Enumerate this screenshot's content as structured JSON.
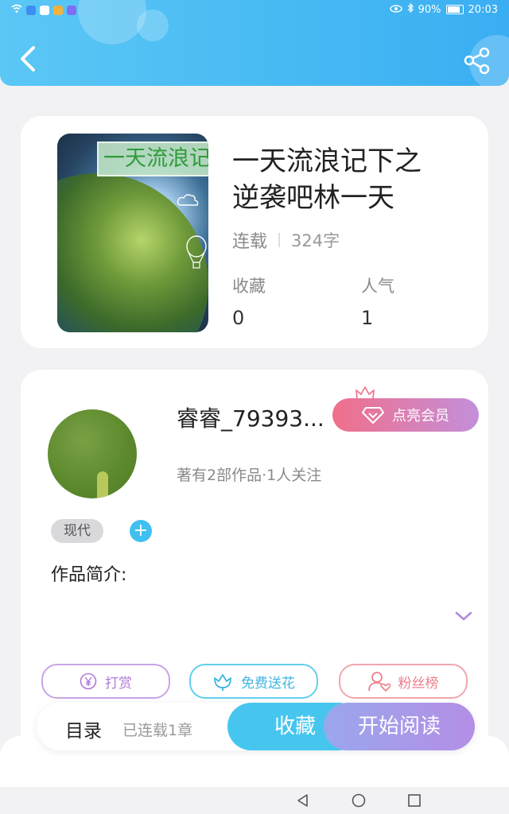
{
  "status": {
    "battery": "90%",
    "time": "20:03"
  },
  "book": {
    "cover_banner": "一天流浪记",
    "title_line1": "一天流浪记下之",
    "title_line2": "逆袭吧林一天",
    "status": "连载",
    "word_count": "324字",
    "favorites_label": "收藏",
    "favorites_value": "0",
    "popularity_label": "人气",
    "popularity_value": "1"
  },
  "author": {
    "name": "睿睿_79393...",
    "vip_label": "点亮会员",
    "info": "著有2部作品·1人关注",
    "genre_tag": "现代",
    "add_tag": "+"
  },
  "intro": {
    "label": "作品简介:"
  },
  "actions": {
    "reward": "打赏",
    "flower": "免费送花",
    "fans": "粉丝榜"
  },
  "bottom": {
    "toc": "目录",
    "chapters": "已连载1章",
    "collect": "收藏",
    "read": "开始阅读"
  },
  "colors": {
    "header": "#46b9f3",
    "accent_blue": "#46c6ef",
    "vip_pink": "#f06f8a",
    "read_purple": "#b48ee6"
  }
}
